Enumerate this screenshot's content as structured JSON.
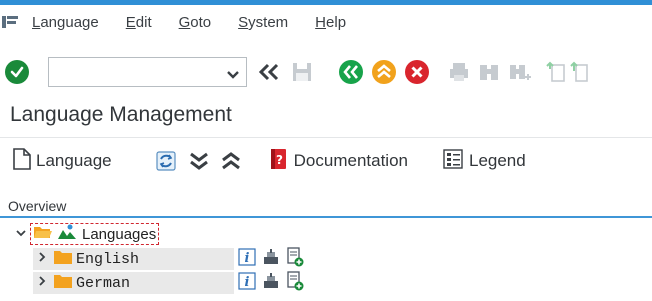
{
  "menu": {
    "items": [
      {
        "label": "Language"
      },
      {
        "label": "Edit"
      },
      {
        "label": "Goto"
      },
      {
        "label": "System"
      },
      {
        "label": "Help"
      }
    ]
  },
  "toolbar": {
    "command_field_value": "",
    "icons": [
      "ok-icon",
      "back-double-arrow-icon",
      "save-icon",
      "back-icon",
      "exit-icon",
      "cancel-icon",
      "print-icon",
      "find-icon",
      "find-next-icon",
      "first-page-icon",
      "previous-page-icon"
    ]
  },
  "page": {
    "title": "Language Management"
  },
  "app_toolbar": {
    "new_language_label": "Language",
    "documentation_label": "Documentation",
    "legend_label": "Legend"
  },
  "overview": {
    "label": "Overview",
    "root_label": "Languages",
    "children": [
      {
        "label": "English"
      },
      {
        "label": "German"
      }
    ]
  },
  "colors": {
    "accent": "#2f8fd6",
    "ok_green": "#1a8a3a",
    "nav_green": "#17a34a",
    "exit_orange": "#f1a21c",
    "cancel_red": "#d9252d",
    "folder_orange": "#f3a21f"
  }
}
